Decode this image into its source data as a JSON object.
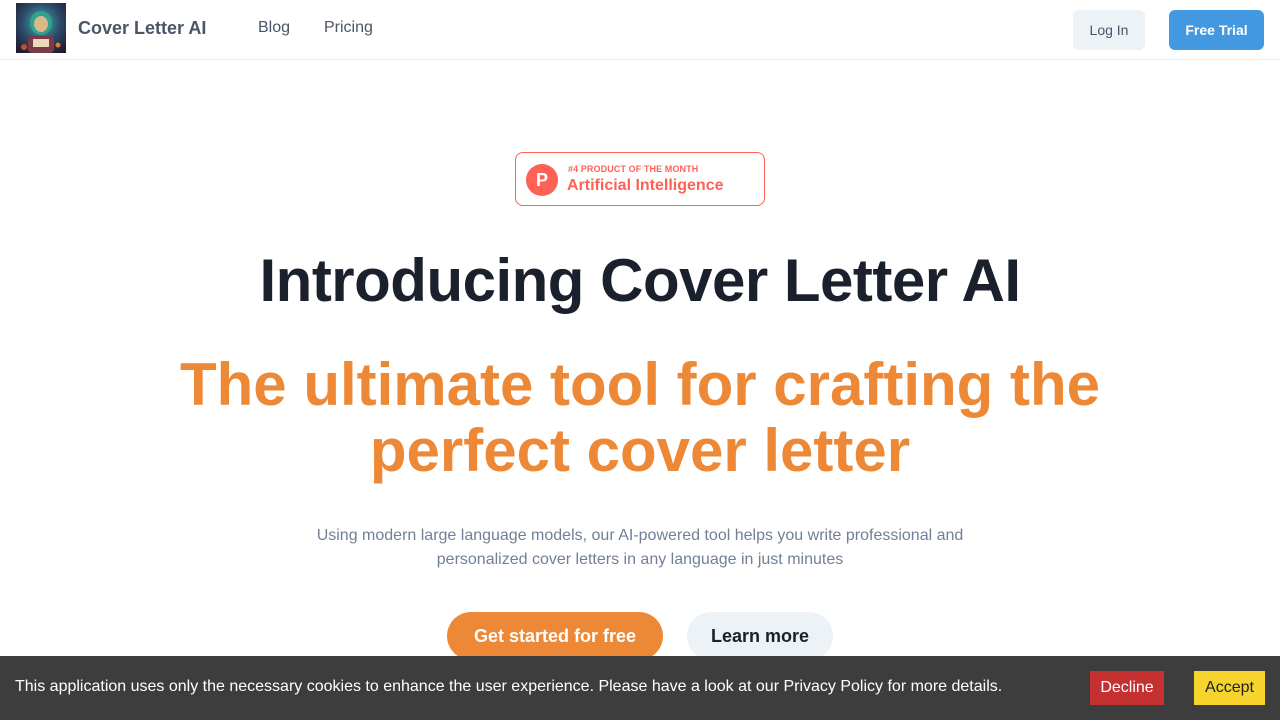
{
  "nav": {
    "brand": "Cover Letter AI",
    "logo_icon": "robot-portrait-logo",
    "links": [
      {
        "label": "Blog"
      },
      {
        "label": "Pricing"
      }
    ],
    "login_label": "Log In",
    "trial_label": "Free Trial"
  },
  "badge": {
    "icon": "product-hunt-icon",
    "icon_letter": "P",
    "small_text": "#4 PRODUCT OF THE MONTH",
    "big_text": "Artificial Intelligence"
  },
  "hero": {
    "title": "Introducing Cover Letter AI",
    "subtitle": "The ultimate tool for crafting the perfect cover letter",
    "description": "Using modern large language models, our AI-powered tool helps you write professional and personalized cover letters in any language in just minutes",
    "primary_cta": "Get started for free",
    "secondary_cta": "Learn more"
  },
  "cookie": {
    "text": "This application uses only the necessary cookies to enhance the user experience. Please have a look at our Privacy Policy for more details.",
    "decline_label": "Decline",
    "accept_label": "Accept"
  },
  "colors": {
    "accent_orange": "#ed8936",
    "accent_blue": "#4299e1",
    "product_hunt": "#ff6154",
    "decline_red": "#c53030",
    "accept_yellow": "#f6d32d"
  }
}
